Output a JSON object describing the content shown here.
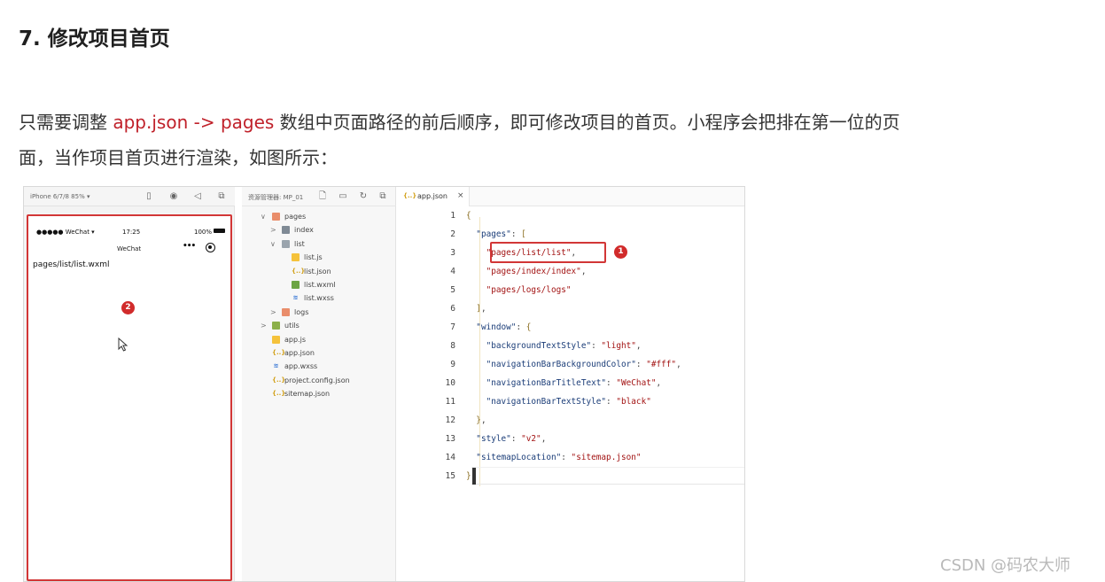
{
  "article": {
    "heading": "7. 修改项目首页",
    "para_1": "只需要调整 ",
    "para_hl_1": "app.json -> pages",
    "para_2": " 数组中页面路径的前后顺序，即可修改项目的首页。小程序会把排在第一位的页",
    "para_3": "面，当作项目首页进行渲染，如图所示："
  },
  "simulator": {
    "device_label": "iPhone 6/7/8 85% ▾",
    "status_signal": "●●●●● WeChat",
    "status_time": "17:25",
    "status_battery": "100%",
    "nav_title": "WeChat",
    "capsule_dots": "•••",
    "page_path": "pages/list/list.wxml",
    "badge": "2"
  },
  "explorer": {
    "title": "资源管理器: MP_01",
    "tree": [
      {
        "name": "pages",
        "depth": 0,
        "arrow": "∨",
        "icon": "folder-pages"
      },
      {
        "name": "index",
        "depth": 1,
        "arrow": ">",
        "icon": "folder"
      },
      {
        "name": "list",
        "depth": 1,
        "arrow": "∨",
        "icon": "folder-open"
      },
      {
        "name": "list.js",
        "depth": 2,
        "arrow": "",
        "icon": "js"
      },
      {
        "name": "list.json",
        "depth": 2,
        "arrow": "",
        "icon": "json"
      },
      {
        "name": "list.wxml",
        "depth": 2,
        "arrow": "",
        "icon": "wxml"
      },
      {
        "name": "list.wxss",
        "depth": 2,
        "arrow": "",
        "icon": "wxss"
      },
      {
        "name": "logs",
        "depth": 1,
        "arrow": ">",
        "icon": "folder-pages"
      },
      {
        "name": "utils",
        "depth": 0,
        "arrow": ">",
        "icon": "folder-utils"
      },
      {
        "name": "app.js",
        "depth": 0,
        "arrow": "",
        "icon": "js"
      },
      {
        "name": "app.json",
        "depth": 0,
        "arrow": "",
        "icon": "json"
      },
      {
        "name": "app.wxss",
        "depth": 0,
        "arrow": "",
        "icon": "wxss"
      },
      {
        "name": "project.config.json",
        "depth": 0,
        "arrow": "",
        "icon": "json"
      },
      {
        "name": "sitemap.json",
        "depth": 0,
        "arrow": "",
        "icon": "json"
      }
    ]
  },
  "editor": {
    "tab_icon": "{..}",
    "tab_label": "app.json",
    "tab_close": "×",
    "badge": "1",
    "lines": [
      {
        "n": "1",
        "parts": [
          [
            "brk",
            "{"
          ]
        ]
      },
      {
        "n": "2",
        "parts": [
          [
            "punc",
            "  "
          ],
          [
            "key",
            "\"pages\""
          ],
          [
            "punc",
            ": "
          ],
          [
            "brk",
            "["
          ]
        ]
      },
      {
        "n": "3",
        "parts": [
          [
            "punc",
            "    "
          ],
          [
            "str",
            "\"pages/list/list\""
          ],
          [
            "punc",
            ","
          ]
        ]
      },
      {
        "n": "4",
        "parts": [
          [
            "punc",
            "    "
          ],
          [
            "str",
            "\"pages/index/index\""
          ],
          [
            "punc",
            ","
          ]
        ]
      },
      {
        "n": "5",
        "parts": [
          [
            "punc",
            "    "
          ],
          [
            "str",
            "\"pages/logs/logs\""
          ]
        ]
      },
      {
        "n": "6",
        "parts": [
          [
            "punc",
            "  "
          ],
          [
            "brk",
            "]"
          ],
          [
            "punc",
            ","
          ]
        ]
      },
      {
        "n": "7",
        "parts": [
          [
            "punc",
            "  "
          ],
          [
            "key",
            "\"window\""
          ],
          [
            "punc",
            ": "
          ],
          [
            "brk",
            "{"
          ]
        ]
      },
      {
        "n": "8",
        "parts": [
          [
            "punc",
            "    "
          ],
          [
            "key",
            "\"backgroundTextStyle\""
          ],
          [
            "punc",
            ": "
          ],
          [
            "str",
            "\"light\""
          ],
          [
            "punc",
            ","
          ]
        ]
      },
      {
        "n": "9",
        "parts": [
          [
            "punc",
            "    "
          ],
          [
            "key",
            "\"navigationBarBackgroundColor\""
          ],
          [
            "punc",
            ": "
          ],
          [
            "str",
            "\"#fff\""
          ],
          [
            "punc",
            ","
          ]
        ]
      },
      {
        "n": "10",
        "parts": [
          [
            "punc",
            "    "
          ],
          [
            "key",
            "\"navigationBarTitleText\""
          ],
          [
            "punc",
            ": "
          ],
          [
            "str",
            "\"WeChat\""
          ],
          [
            "punc",
            ","
          ]
        ]
      },
      {
        "n": "11",
        "parts": [
          [
            "punc",
            "    "
          ],
          [
            "key",
            "\"navigationBarTextStyle\""
          ],
          [
            "punc",
            ": "
          ],
          [
            "str",
            "\"black\""
          ]
        ]
      },
      {
        "n": "12",
        "parts": [
          [
            "punc",
            "  "
          ],
          [
            "brk",
            "}"
          ],
          [
            "punc",
            ","
          ]
        ]
      },
      {
        "n": "13",
        "parts": [
          [
            "punc",
            "  "
          ],
          [
            "key",
            "\"style\""
          ],
          [
            "punc",
            ": "
          ],
          [
            "str",
            "\"v2\""
          ],
          [
            "punc",
            ","
          ]
        ]
      },
      {
        "n": "14",
        "parts": [
          [
            "punc",
            "  "
          ],
          [
            "key",
            "\"sitemapLocation\""
          ],
          [
            "punc",
            ": "
          ],
          [
            "str",
            "\"sitemap.json\""
          ]
        ]
      },
      {
        "n": "15",
        "parts": [
          [
            "brk",
            "}"
          ]
        ]
      }
    ]
  },
  "watermark": "CSDN @码农大师",
  "colors": {
    "highlight_text": "#c0212a",
    "annotation_red": "#d23636",
    "json_key": "#1b3d78",
    "json_string": "#a31515"
  }
}
